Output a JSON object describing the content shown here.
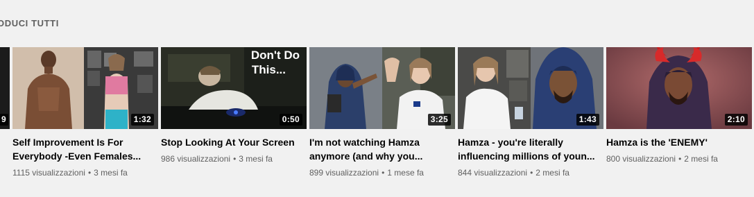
{
  "section": {
    "header": "ODUCI TUTTI"
  },
  "partial": {
    "duration": "9"
  },
  "videos": [
    {
      "title": "Self Improvement Is For Everybody -Even Females...",
      "duration": "1:32",
      "views": "1115 visualizzazioni",
      "age": "3 mesi fa",
      "thumb_text": ""
    },
    {
      "title": "Stop Looking At Your Screen",
      "duration": "0:50",
      "views": "986 visualizzazioni",
      "age": "3 mesi fa",
      "thumb_text_line1": "Don't Do",
      "thumb_text_line2": "This..."
    },
    {
      "title": "I'm not watching Hamza anymore (and why you...",
      "duration": "3:25",
      "views": "899 visualizzazioni",
      "age": "1 mese fa"
    },
    {
      "title": "Hamza - you're literally influencing millions of youn...",
      "duration": "1:43",
      "views": "844 visualizzazioni",
      "age": "2 mesi fa"
    },
    {
      "title": "Hamza is the 'ENEMY'",
      "duration": "2:10",
      "views": "800 visualizzazioni",
      "age": "2 mesi fa"
    }
  ],
  "separator": "•",
  "colors": {
    "background": "#f1f1f1",
    "title_text": "#030303",
    "meta_text": "#606060",
    "badge_bg": "#000000"
  }
}
